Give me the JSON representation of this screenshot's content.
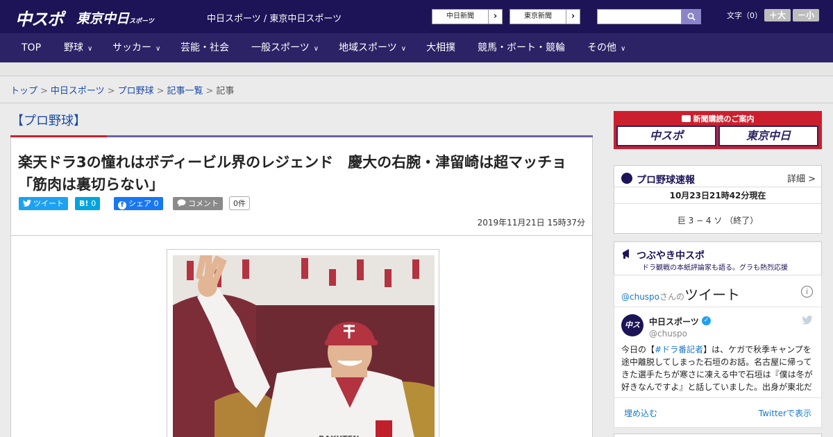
{
  "header": {
    "logo_chuspo": "中スポ",
    "logo_tokyo": "東京中日",
    "logo_tokyo_sub": "スポーツ",
    "site_title": "中日スポーツ / 東京中日スポーツ",
    "btn_chunichi": "中日新聞",
    "btn_tokyo": "東京新聞",
    "font_size_label": "文字（0）",
    "font_plus": "＋大",
    "font_minus": "－小"
  },
  "nav": {
    "items": [
      {
        "label": "TOP"
      },
      {
        "label": "野球"
      },
      {
        "label": "サッカー"
      },
      {
        "label": "芸能・社会"
      },
      {
        "label": "一般スポーツ"
      },
      {
        "label": "地域スポーツ"
      },
      {
        "label": "大相撲"
      },
      {
        "label": "競馬・ボート・競輪"
      },
      {
        "label": "その他"
      }
    ]
  },
  "breadcrumb": {
    "items": [
      "トップ",
      "中日スポーツ",
      "プロ野球",
      "記事一覧",
      "記事"
    ],
    "sep": ">"
  },
  "article": {
    "category": "【プロ野球】",
    "headline": "楽天ドラ3の憧れはボディービル界のレジェンド　慶大の右腕・津留崎は超マッチョ「筋肉は裏切らない」",
    "share_tweet": "ツイート",
    "share_hatena": "B!",
    "share_hatena_count": "0",
    "share_facebook": "シェア",
    "share_facebook_count": "0",
    "share_comment": "コメント",
    "comment_count": "0件",
    "date": "2019年11月21日 15時37分"
  },
  "sidebar": {
    "subscription": "新聞購読のご案内",
    "sub_logo_1": "中スポ",
    "sub_logo_2": "東京中日",
    "baseball": {
      "title": "プロ野球速報",
      "detail": "詳細 >",
      "timestamp": "10月23日21時42分現在",
      "score": "巨 3 − 4 ソ （終了）"
    },
    "tsubuyaki": {
      "title": "つぶやき中スポ",
      "subtitle": "ドラ観戦の本紙評論家も語る。グラも熱烈応援"
    },
    "twitter": {
      "handle_link": "@chuspo",
      "handle_mid": "さんの",
      "heading": "ツイート",
      "info": "i",
      "avatar": "中スポ",
      "name": "中日スポーツ",
      "handle": "@chuspo",
      "text_pre": "今日の【",
      "text_tag": "#ドラ番記者",
      "text_post": "】は、ケガで秋季キャンプを途中離脱してしまった石垣のお話。名古屋に帰ってきた選手たちが寒さに凍える中で石垣は『僕は冬が好きなんですよ』と話していました。出身が東北だ",
      "embed": "埋め込む",
      "view_on": "Twitterで表示"
    }
  },
  "colors": {
    "header": "#1c1457",
    "nav": "#2b2366",
    "accent_red": "#cc1f2d",
    "twitter": "#1da1f2",
    "hatena": "#00a4de",
    "facebook": "#1877f2"
  }
}
